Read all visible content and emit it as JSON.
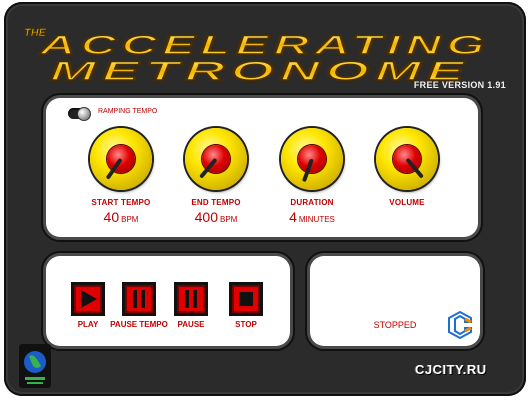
{
  "header": {
    "the": "THE",
    "title_line1": "ACCELERATING",
    "title_line2": "METRONOME",
    "version": "FREE VERSION 1.91"
  },
  "ramping": {
    "label": "RAMPING TEMPO",
    "enabled": true
  },
  "knobs": [
    {
      "label": "START TEMPO",
      "value": "40",
      "unit": "BPM"
    },
    {
      "label": "END TEMPO",
      "value": "400",
      "unit": "BPM"
    },
    {
      "label": "DURATION",
      "value": "4",
      "unit": "MINUTES"
    },
    {
      "label": "VOLUME",
      "value": "",
      "unit": ""
    }
  ],
  "transport": {
    "play": "PLAY",
    "pause_tempo": "PAUSE TEMPO",
    "pause": "PAUSE",
    "stop": "STOP"
  },
  "status": "STOPPED",
  "brand": "CJCITY.RU",
  "colors": {
    "accent": "#c00000",
    "knob": "#ffe600",
    "background": "#2b2b2b"
  }
}
